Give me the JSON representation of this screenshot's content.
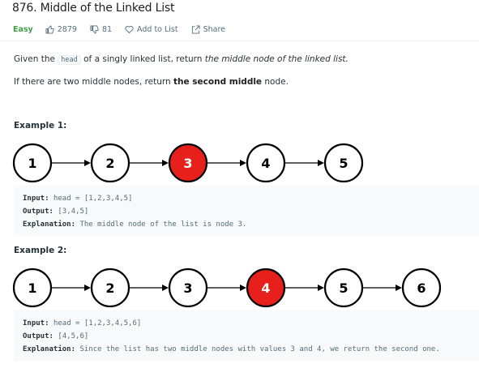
{
  "problem": {
    "title": "876. Middle of the Linked List",
    "difficulty": "Easy",
    "likes": "2879",
    "dislikes": "81",
    "add_to_list": "Add to List",
    "share": "Share"
  },
  "description": {
    "p1_before": "Given the",
    "p1_code": "head",
    "p1_mid": "of a singly linked list, return",
    "p1_em": "the middle node of the linked list.",
    "p2_before": "If there are two middle nodes, return",
    "p2_strong": "the second middle",
    "p2_after": "node."
  },
  "examples": [
    {
      "title": "Example 1:",
      "nodes": [
        "1",
        "2",
        "3",
        "4",
        "5"
      ],
      "highlight_index": 2,
      "input_label": "Input:",
      "input_value": "head = [1,2,3,4,5]",
      "output_label": "Output:",
      "output_value": "[3,4,5]",
      "explanation_label": "Explanation:",
      "explanation_value": "The middle node of the list is node 3."
    },
    {
      "title": "Example 2:",
      "nodes": [
        "1",
        "2",
        "3",
        "4",
        "5",
        "6"
      ],
      "highlight_index": 3,
      "input_label": "Input:",
      "input_value": "head = [1,2,3,4,5,6]",
      "output_label": "Output:",
      "output_value": "[4,5,6]",
      "explanation_label": "Explanation:",
      "explanation_value": "Since the list has two middle nodes with values 3 and 4, we return the second one."
    }
  ],
  "colors": {
    "highlight_fill": "#e8201c",
    "node_fill": "#ffffff",
    "node_stroke": "#000000",
    "easy": "#43a047"
  }
}
